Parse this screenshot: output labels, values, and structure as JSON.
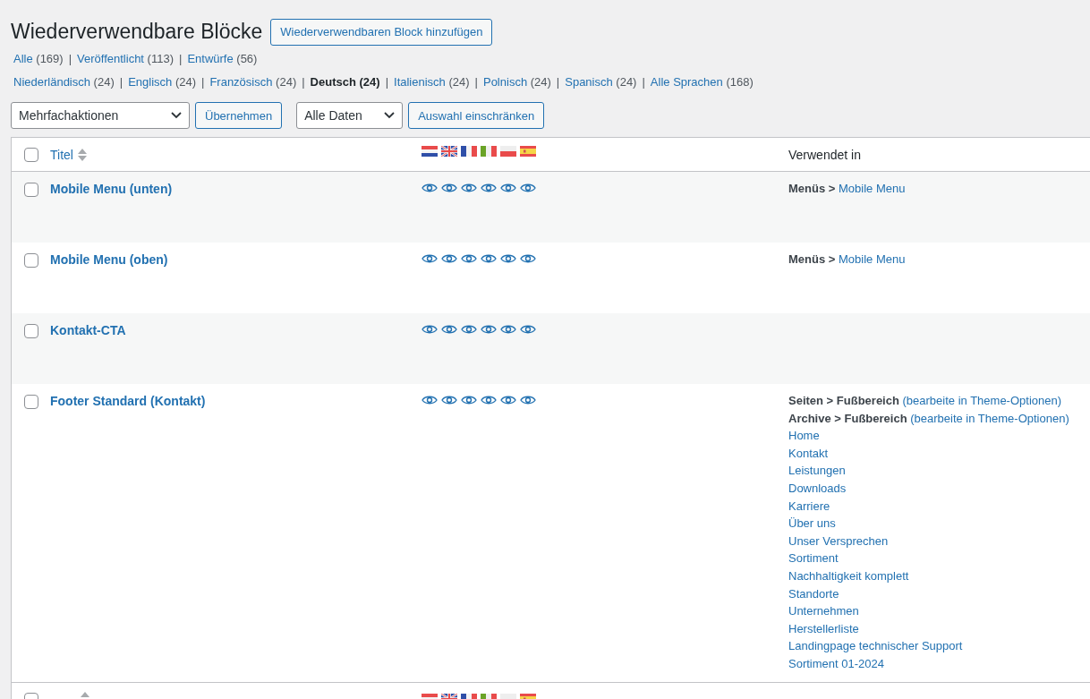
{
  "page": {
    "title": "Wiederverwendbare Blöcke",
    "add_button": "Wiederverwendbaren Block hinzufügen"
  },
  "status_filters": {
    "separator": "|",
    "items": [
      {
        "label": "Alle",
        "count": "(169)",
        "selected": false
      },
      {
        "label": "Veröffentlicht",
        "count": "(113)",
        "selected": false
      },
      {
        "label": "Entwürfe",
        "count": "(56)",
        "selected": false
      }
    ]
  },
  "language_filters": {
    "separator": "|",
    "items": [
      {
        "label": "Niederländisch",
        "count": "(24)",
        "selected": false
      },
      {
        "label": "Englisch",
        "count": "(24)",
        "selected": false
      },
      {
        "label": "Französisch",
        "count": "(24)",
        "selected": false
      },
      {
        "label": "Deutsch",
        "count": "(24)",
        "selected": true
      },
      {
        "label": "Italienisch",
        "count": "(24)",
        "selected": false
      },
      {
        "label": "Polnisch",
        "count": "(24)",
        "selected": false
      },
      {
        "label": "Spanisch",
        "count": "(24)",
        "selected": false
      },
      {
        "label": "Alle Sprachen",
        "count": "(168)",
        "selected": false
      }
    ]
  },
  "toolbar": {
    "bulk_select": "Mehrfachaktionen",
    "apply_button": "Übernehmen",
    "date_select": "Alle Daten",
    "filter_button": "Auswahl einschränken"
  },
  "table": {
    "select_all_checked": false,
    "footer_select_all_checked": false,
    "columns": {
      "title": "Titel",
      "used_in": "Verwendet in"
    },
    "languages": [
      {
        "kind": "nl"
      },
      {
        "kind": "gb"
      },
      {
        "kind": "fr"
      },
      {
        "kind": "it"
      },
      {
        "kind": "pl"
      },
      {
        "kind": "es"
      }
    ],
    "rows": [
      {
        "title": "Mobile Menu (unten)",
        "checked": false,
        "translations": [
          {
            "kind": "view"
          },
          {
            "kind": "view"
          },
          {
            "kind": "view"
          },
          {
            "kind": "view"
          },
          {
            "kind": "view"
          },
          {
            "kind": "view"
          }
        ],
        "used_in": [
          {
            "kind": "path",
            "area": "Menüs",
            "sep": ">",
            "target": "Mobile Menu",
            "target_link": true
          }
        ]
      },
      {
        "title": "Mobile Menu (oben)",
        "checked": false,
        "translations": [
          {
            "kind": "view"
          },
          {
            "kind": "view"
          },
          {
            "kind": "view"
          },
          {
            "kind": "view"
          },
          {
            "kind": "view"
          },
          {
            "kind": "view"
          }
        ],
        "used_in": [
          {
            "kind": "path",
            "area": "Menüs",
            "sep": ">",
            "target": "Mobile Menu",
            "target_link": true
          }
        ]
      },
      {
        "title": "Kontakt-CTA",
        "checked": false,
        "translations": [
          {
            "kind": "view"
          },
          {
            "kind": "view"
          },
          {
            "kind": "view"
          },
          {
            "kind": "view"
          },
          {
            "kind": "view"
          },
          {
            "kind": "view"
          }
        ],
        "used_in": []
      },
      {
        "title": "Footer Standard (Kontakt)",
        "checked": false,
        "translations": [
          {
            "kind": "view"
          },
          {
            "kind": "view"
          },
          {
            "kind": "view"
          },
          {
            "kind": "view"
          },
          {
            "kind": "view"
          },
          {
            "kind": "view"
          }
        ],
        "used_in": [
          {
            "kind": "path",
            "area": "Seiten",
            "sep": ">",
            "target": "Fußbereich",
            "target_link": false,
            "note": "(bearbeite in Theme-Optionen)"
          },
          {
            "kind": "path",
            "area": "Archive",
            "sep": ">",
            "target": "Fußbereich",
            "target_link": false,
            "note": "(bearbeite in Theme-Optionen)"
          },
          {
            "kind": "link",
            "label": "Home"
          },
          {
            "kind": "link",
            "label": "Kontakt"
          },
          {
            "kind": "link",
            "label": "Leistungen"
          },
          {
            "kind": "link",
            "label": "Downloads"
          },
          {
            "kind": "link",
            "label": "Karriere"
          },
          {
            "kind": "link",
            "label": "Über uns"
          },
          {
            "kind": "link",
            "label": "Unser Versprechen"
          },
          {
            "kind": "link",
            "label": "Sortiment"
          },
          {
            "kind": "link",
            "label": "Nachhaltigkeit komplett"
          },
          {
            "kind": "link",
            "label": "Standorte"
          },
          {
            "kind": "link",
            "label": "Unternehmen"
          },
          {
            "kind": "link",
            "label": "Herstellerliste"
          },
          {
            "kind": "link",
            "label": "Landingpage technischer Support"
          },
          {
            "kind": "link",
            "label": "Sortiment 01-2024"
          }
        ]
      }
    ]
  }
}
